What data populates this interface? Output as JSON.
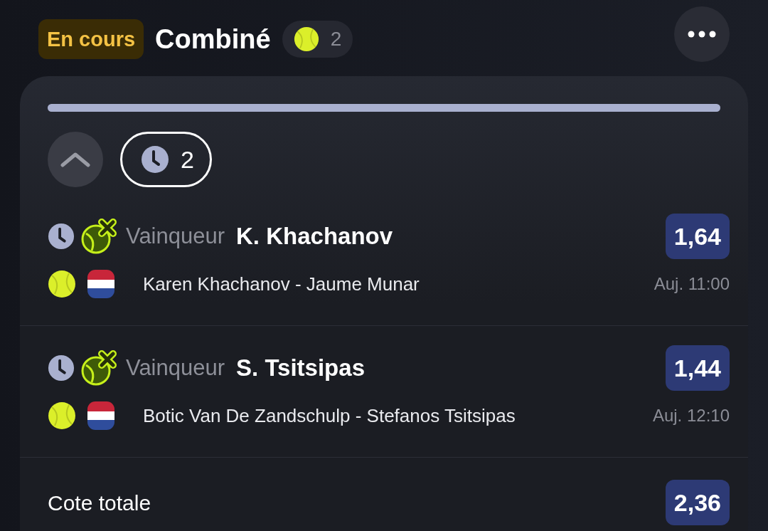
{
  "header": {
    "status": "En cours",
    "title": "Combiné",
    "sport_count": "2"
  },
  "progress": {
    "level": 1
  },
  "toggle": {
    "expanded": true
  },
  "pending": {
    "count": "2"
  },
  "legs": [
    {
      "market": "Vainqueur",
      "selection": "K. Khachanov",
      "odds": "1,64",
      "match": "Karen Khachanov - Jaume Munar",
      "time": "Auj. 11:00"
    },
    {
      "market": "Vainqueur",
      "selection": "S. Tsitsipas",
      "odds": "1,44",
      "match": "Botic Van De Zandschulp - Stefanos Tsitsipas",
      "time": "Auj. 12:10"
    }
  ],
  "total": {
    "label": "Cote totale",
    "odds": "2,36"
  }
}
